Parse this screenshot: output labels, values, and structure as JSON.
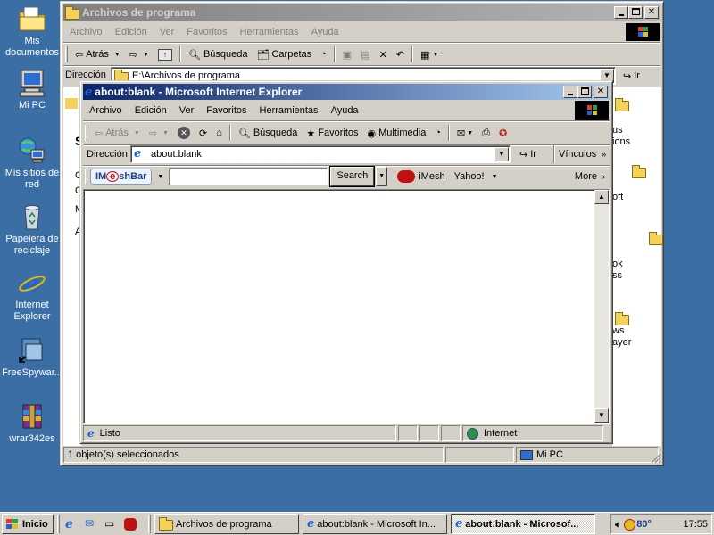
{
  "desktop": {
    "icons": [
      {
        "label": "Mis documentos",
        "icon": "my-documents-icon"
      },
      {
        "label": "Mi PC",
        "icon": "my-computer-icon"
      },
      {
        "label": "Mis sitios de red",
        "icon": "network-places-icon"
      },
      {
        "label": "Papelera de reciclaje",
        "icon": "recycle-bin-icon"
      },
      {
        "label": "Internet Explorer",
        "icon": "internet-explorer-icon"
      },
      {
        "label": "FreeSpywar...",
        "icon": "program-icon"
      },
      {
        "label": "wrar342es",
        "icon": "winrar-archive-icon"
      }
    ]
  },
  "explorer": {
    "title": "Archivos de programa",
    "menu": [
      "Archivo",
      "Edición",
      "Ver",
      "Favoritos",
      "Herramientas",
      "Ayuda"
    ],
    "toolbar": {
      "back": "Atrás",
      "search": "Búsqueda",
      "folders": "Carpetas"
    },
    "address_label": "Dirección",
    "address_value": "E:\\Archivos de programa",
    "go_label": "Ir",
    "side_letters": [
      "S",
      "C",
      "M",
      "A"
    ],
    "right_items": [
      "us",
      "ions",
      "oft",
      "ok",
      "ss",
      "ws",
      "ayer"
    ],
    "status_left": "1 objeto(s) seleccionados",
    "status_right": "Mi PC"
  },
  "ie": {
    "title": "about:blank - Microsoft Internet Explorer",
    "menu": [
      "Archivo",
      "Edición",
      "Ver",
      "Favoritos",
      "Herramientas",
      "Ayuda"
    ],
    "toolbar": {
      "back": "Atrás",
      "search": "Búsqueda",
      "favorites": "Favoritos",
      "media": "Multimedia"
    },
    "address_label": "Dirección",
    "address_value": "about:blank",
    "go_label": "Ir",
    "links_label": "Vínculos",
    "meshbar": {
      "logo_left": "IM",
      "logo_mid": "e",
      "logo_right": "shBar",
      "search_value": "",
      "search_button": "Search",
      "imesh_label": "iMesh",
      "yahoo_label": "Yahoo!",
      "more_label": "More"
    },
    "status_text": "Listo",
    "zone_text": "Internet"
  },
  "taskbar": {
    "start_label": "Inicio",
    "tasks": [
      {
        "label": "Archivos de programa",
        "icon": "folder-icon"
      },
      {
        "label": "about:blank - Microsoft In...",
        "icon": "ie-icon"
      },
      {
        "label": "about:blank - Microsof...",
        "icon": "ie-icon"
      }
    ],
    "temperature": "80°",
    "clock": "17:55"
  }
}
